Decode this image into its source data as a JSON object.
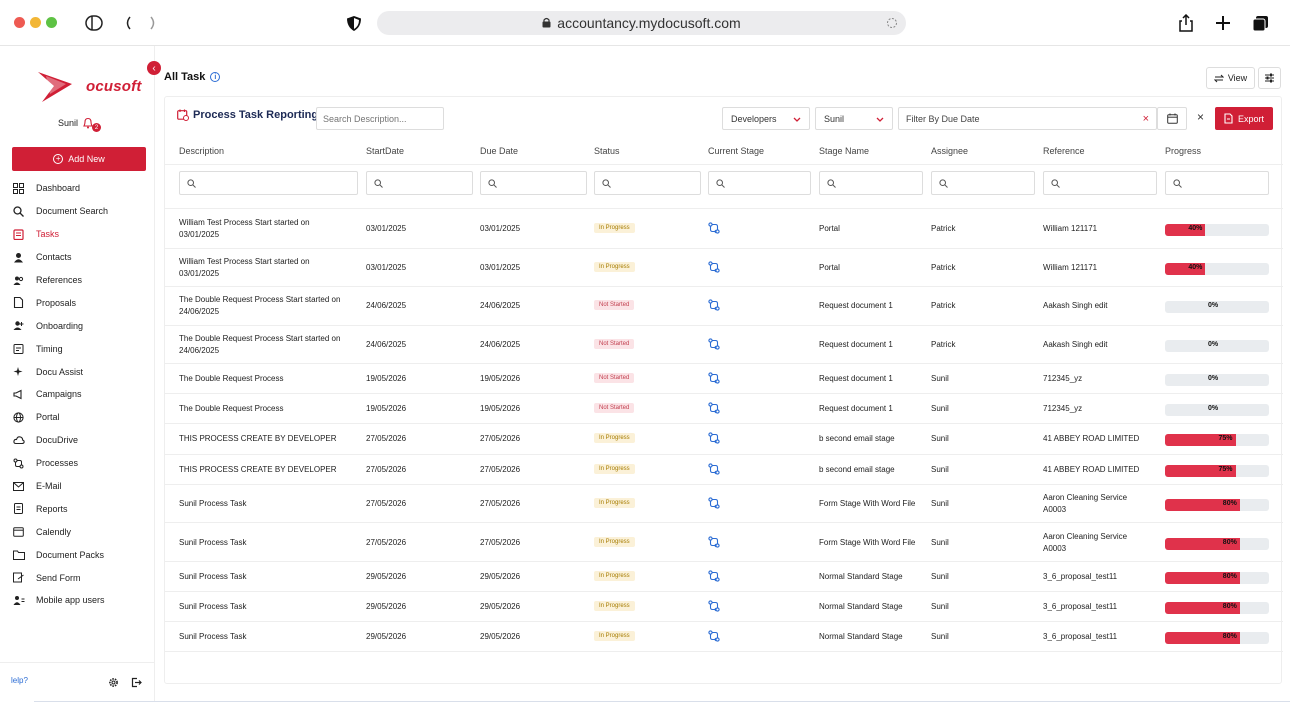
{
  "browser": {
    "url": "accountancy.mydocusoft.com"
  },
  "sidebar": {
    "logo_text": "ocusoft",
    "user": "Sunil",
    "notification_count": "2",
    "add_new": "Add New",
    "items": [
      {
        "label": "Dashboard",
        "icon": "dashboard-icon"
      },
      {
        "label": "Document Search",
        "icon": "search-icon"
      },
      {
        "label": "Tasks",
        "icon": "tasks-icon",
        "active": true
      },
      {
        "label": "Contacts",
        "icon": "contacts-icon"
      },
      {
        "label": "References",
        "icon": "references-icon"
      },
      {
        "label": "Proposals",
        "icon": "proposals-icon"
      },
      {
        "label": "Onboarding",
        "icon": "onboarding-icon"
      },
      {
        "label": "Timing",
        "icon": "timing-icon"
      },
      {
        "label": "Docu Assist",
        "icon": "sparkle-icon"
      },
      {
        "label": "Campaigns",
        "icon": "megaphone-icon"
      },
      {
        "label": "Portal",
        "icon": "globe-icon"
      },
      {
        "label": "DocuDrive",
        "icon": "cloud-icon"
      },
      {
        "label": "Processes",
        "icon": "processes-icon"
      },
      {
        "label": "E-Mail",
        "icon": "mail-icon"
      },
      {
        "label": "Reports",
        "icon": "reports-icon"
      },
      {
        "label": "Calendly",
        "icon": "calendar-icon"
      },
      {
        "label": "Document Packs",
        "icon": "folder-icon"
      },
      {
        "label": "Send Form",
        "icon": "send-form-icon"
      },
      {
        "label": "Mobile app users",
        "icon": "mobile-users-icon"
      }
    ],
    "help": "lelp?"
  },
  "main": {
    "title": "All Task",
    "view_label": "View"
  },
  "panel": {
    "title": "Process Task Reporting",
    "search_placeholder": "Search Description...",
    "developers": "Developers",
    "user": "Sunil",
    "due_date_placeholder": "Filter By Due Date",
    "export": "Export"
  },
  "columns": [
    "Description",
    "StartDate",
    "Due Date",
    "Status",
    "Current Stage",
    "Stage Name",
    "Assignee",
    "Reference",
    "Progress"
  ],
  "colors": {
    "accent": "#d01f36",
    "progress_fill": "#e0324b",
    "status_in_progress_bg": "#fbf1d8",
    "status_not_started_bg": "#fbe3e6"
  },
  "rows": [
    {
      "desc1": "William Test Process Start started on",
      "desc2": "03/01/2025",
      "start": "03/01/2025",
      "due": "03/01/2025",
      "status": "In Progress",
      "stage": "Portal",
      "assignee": "Patrick",
      "ref1": "William 121171",
      "ref2": "",
      "progress": 40,
      "pct": "40%"
    },
    {
      "desc1": "William Test Process Start started on",
      "desc2": "03/01/2025",
      "start": "03/01/2025",
      "due": "03/01/2025",
      "status": "In Progress",
      "stage": "Portal",
      "assignee": "Patrick",
      "ref1": "William 121171",
      "ref2": "",
      "progress": 40,
      "pct": "40%"
    },
    {
      "desc1": "The Double Request Process Start started on",
      "desc2": "24/06/2025",
      "start": "24/06/2025",
      "due": "24/06/2025",
      "status": "Not Started",
      "stage": "Request document 1",
      "assignee": "Patrick",
      "ref1": "Aakash Singh edit",
      "ref2": "",
      "progress": 0,
      "pct": "0%"
    },
    {
      "desc1": "The Double Request Process Start started on",
      "desc2": "24/06/2025",
      "start": "24/06/2025",
      "due": "24/06/2025",
      "status": "Not Started",
      "stage": "Request document 1",
      "assignee": "Patrick",
      "ref1": "Aakash Singh edit",
      "ref2": "",
      "progress": 0,
      "pct": "0%"
    },
    {
      "desc1": "The Double Request Process",
      "desc2": "",
      "start": "19/05/2026",
      "due": "19/05/2026",
      "status": "Not Started",
      "stage": "Request document 1",
      "assignee": "Sunil",
      "ref1": "712345_yz",
      "ref2": "",
      "progress": 0,
      "pct": "0%"
    },
    {
      "desc1": "The Double Request Process",
      "desc2": "",
      "start": "19/05/2026",
      "due": "19/05/2026",
      "status": "Not Started",
      "stage": "Request document 1",
      "assignee": "Sunil",
      "ref1": "712345_yz",
      "ref2": "",
      "progress": 0,
      "pct": "0%"
    },
    {
      "desc1": "THIS PROCESS CREATE BY DEVELOPER",
      "desc2": "",
      "start": "27/05/2026",
      "due": "27/05/2026",
      "status": "In Progress",
      "stage": "b second email stage",
      "assignee": "Sunil",
      "ref1": "41 ABBEY ROAD LIMITED",
      "ref2": "",
      "progress": 75,
      "pct": "75%"
    },
    {
      "desc1": "THIS PROCESS CREATE BY DEVELOPER",
      "desc2": "",
      "start": "27/05/2026",
      "due": "27/05/2026",
      "status": "In Progress",
      "stage": "b second email stage",
      "assignee": "Sunil",
      "ref1": "41 ABBEY ROAD LIMITED",
      "ref2": "",
      "progress": 75,
      "pct": "75%"
    },
    {
      "desc1": "Sunil Process Task",
      "desc2": "",
      "start": "27/05/2026",
      "due": "27/05/2026",
      "status": "In Progress",
      "stage": "Form Stage With Word File",
      "assignee": "Sunil",
      "ref1": "Aaron Cleaning Service",
      "ref2": "A0003",
      "progress": 80,
      "pct": "80%"
    },
    {
      "desc1": "Sunil Process Task",
      "desc2": "",
      "start": "27/05/2026",
      "due": "27/05/2026",
      "status": "In Progress",
      "stage": "Form Stage With Word File",
      "assignee": "Sunil",
      "ref1": "Aaron Cleaning Service",
      "ref2": "A0003",
      "progress": 80,
      "pct": "80%"
    },
    {
      "desc1": "Sunil Process Task",
      "desc2": "",
      "start": "29/05/2026",
      "due": "29/05/2026",
      "status": "In Progress",
      "stage": "Normal Standard Stage",
      "assignee": "Sunil",
      "ref1": "3_6_proposal_test11",
      "ref2": "",
      "progress": 80,
      "pct": "80%"
    },
    {
      "desc1": "Sunil Process Task",
      "desc2": "",
      "start": "29/05/2026",
      "due": "29/05/2026",
      "status": "In Progress",
      "stage": "Normal Standard Stage",
      "assignee": "Sunil",
      "ref1": "3_6_proposal_test11",
      "ref2": "",
      "progress": 80,
      "pct": "80%"
    },
    {
      "desc1": "Sunil Process Task",
      "desc2": "",
      "start": "29/05/2026",
      "due": "29/05/2026",
      "status": "In Progress",
      "stage": "Normal Standard Stage",
      "assignee": "Sunil",
      "ref1": "3_6_proposal_test11",
      "ref2": "",
      "progress": 80,
      "pct": "80%"
    }
  ]
}
